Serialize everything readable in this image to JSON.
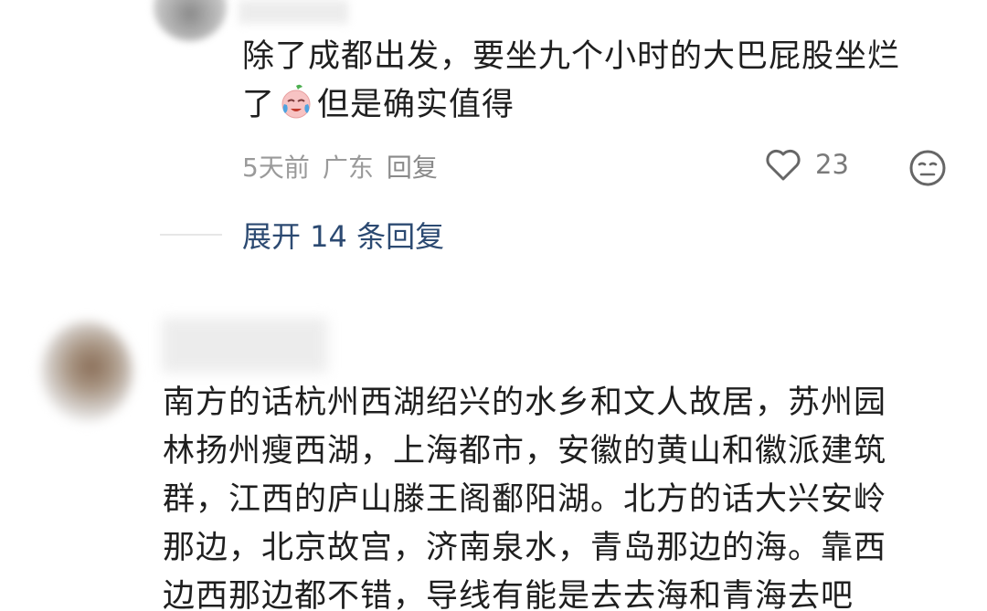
{
  "comment1": {
    "text_line1": "除了成都出发，要坐九个小时的大巴屁股坐烂",
    "text_line2_before": "了",
    "text_line2_after": "但是确实值得",
    "emoji_icon": "crying-face-emoji",
    "meta": {
      "time": "5天前",
      "location": "广东",
      "reply_label": "回复"
    },
    "likes": "23",
    "like_icon": "heart-outline-icon",
    "dislike_icon": "meh-face-icon"
  },
  "replies": {
    "expand_label": "展开 14 条回复"
  },
  "comment2": {
    "lines": [
      "南方的话杭州西湖绍兴的水乡和文人故居，苏州园",
      "林扬州瘦西湖，上海都市，安徽的黄山和徽派建筑",
      "群，江西的庐山滕王阁鄱阳湖。北方的话大兴安岭",
      "那边，北京故宫，济南泉水，青岛那边的海。靠西",
      "边西那边都不错，导线有能是去去海和青海去吧"
    ]
  },
  "colors": {
    "text": "#1f1f1f",
    "meta": "#9a9a9a",
    "link": "#2c4a72",
    "divider": "#e6e6e6"
  }
}
